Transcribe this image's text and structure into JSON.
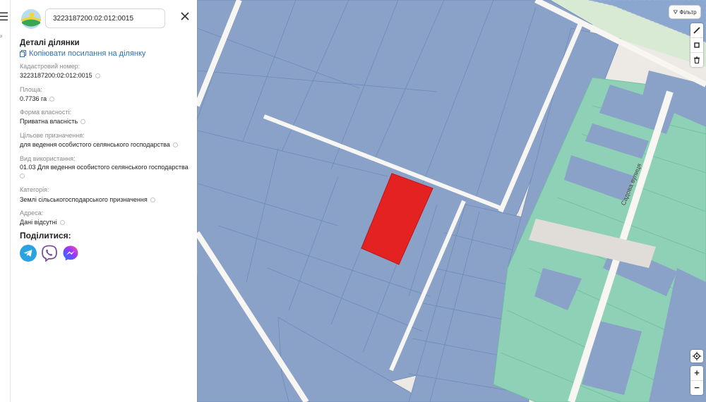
{
  "search": {
    "value": "3223187200:02:012:0015"
  },
  "details": {
    "title": "Деталі ділянки",
    "copy_link": "Копіювати посилання на ділянку",
    "fields": [
      {
        "label": "Кадастровий номер:",
        "value": "3223187200:02:012:0015"
      },
      {
        "label": "Площа:",
        "value": "0.7736 га"
      },
      {
        "label": "Форма власності:",
        "value": "Приватна власність"
      },
      {
        "label": "Цільове призначення:",
        "value": "для ведення особистого селянського господарства"
      },
      {
        "label": "Вид використання:",
        "value": "01.03 Для ведення особистого селянського господарства"
      },
      {
        "label": "Категорія:",
        "value": "Землі сільськогосподарського призначення"
      },
      {
        "label": "Адреса:",
        "value": "Дані відсутні"
      }
    ]
  },
  "share": {
    "title": "Поділитися:",
    "icons": [
      "telegram-icon",
      "viber-icon",
      "messenger-icon"
    ]
  },
  "map": {
    "filter_label": "Фільтр",
    "street_label": "Садова вулиця",
    "zoom_in": "+",
    "zoom_out": "−",
    "colors": {
      "selected": "#e52222",
      "private_parcels": "#8aa2c8",
      "green_parcels": "#8fd1b6",
      "background": "#edeae5"
    }
  }
}
